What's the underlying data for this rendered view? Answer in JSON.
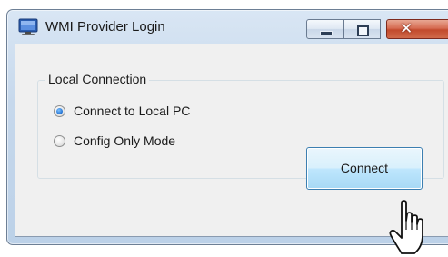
{
  "window": {
    "title": "WMI Provider Login",
    "app_icon": "computer-monitor-icon",
    "caption_buttons": {
      "minimize_icon": "minimize-icon",
      "maximize_icon": "maximize-icon",
      "close_icon": "close-icon",
      "close_glyph": "✕"
    }
  },
  "group": {
    "label": "Local Connection",
    "options": [
      {
        "label": "Connect to Local PC",
        "selected": true
      },
      {
        "label": "Config Only Mode",
        "selected": false
      }
    ]
  },
  "actions": {
    "connect_label": "Connect"
  },
  "cursor": {
    "icon": "hand-pointer-icon"
  },
  "colors": {
    "title_bar": "#c6d8ec",
    "client_background": "#f0f0f0",
    "close_button": "#c24a2c",
    "default_button_border": "#3c7fb1",
    "radio_selected": "#1f6fd0"
  }
}
